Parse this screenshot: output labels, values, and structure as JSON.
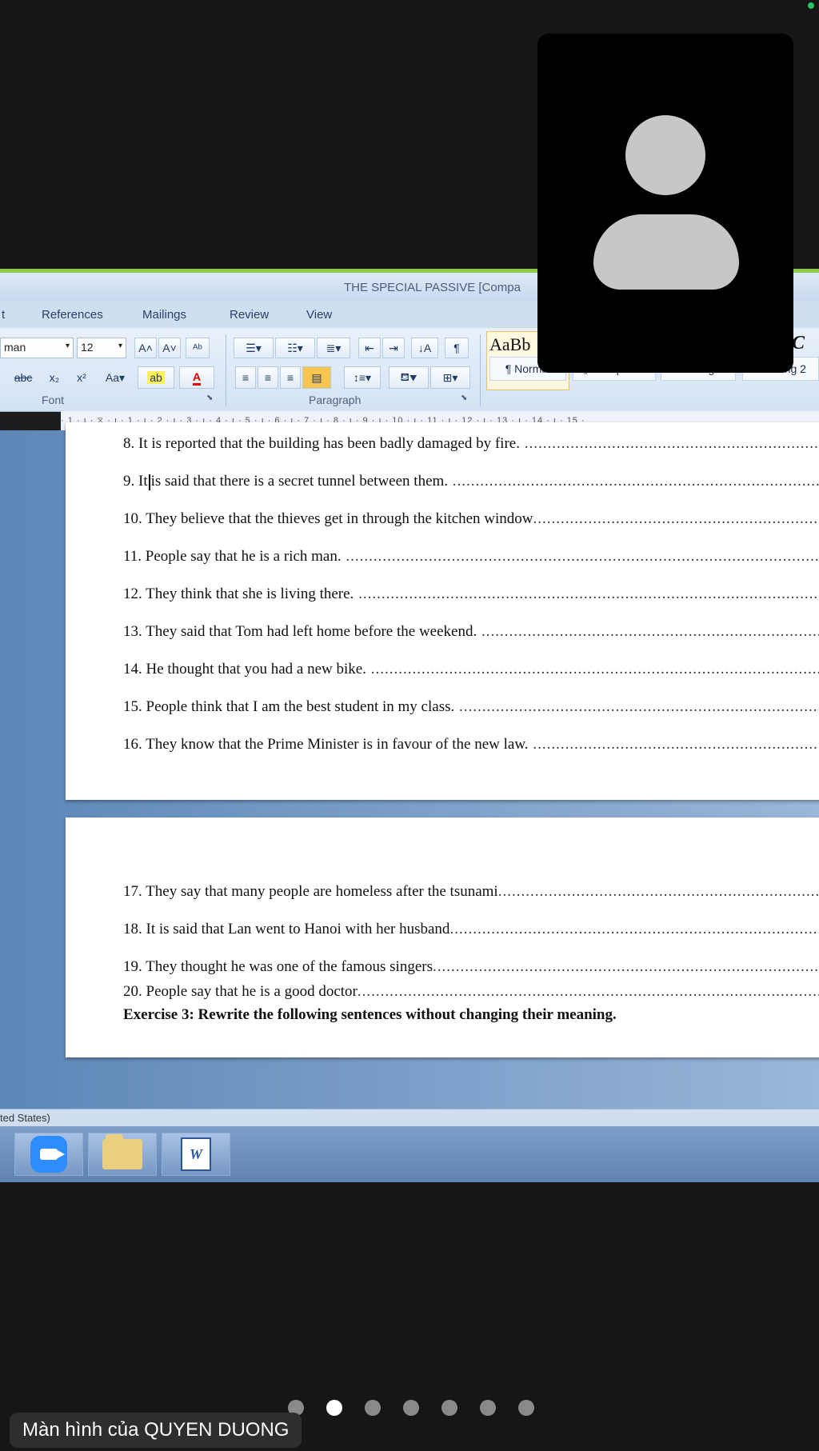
{
  "window": {
    "title": "THE SPECIAL PASSIVE [Compa"
  },
  "ribbon_tabs": [
    "t",
    "References",
    "Mailings",
    "Review",
    "View"
  ],
  "font": {
    "name": "man",
    "size": "12"
  },
  "groups": {
    "font_label": "Font",
    "paragraph_label": "Paragraph"
  },
  "styles": {
    "preview_left": "AaBb",
    "preview_right": "bC",
    "items": [
      "¶ Normal",
      "¶ No Spaci...",
      "Heading 1",
      "Heading 2"
    ]
  },
  "ruler": {
    "text": "· 1 · ı · ⧖ · ı · 1 · ı · 2 · ı · 3 · ı · 4 · ı · 5 · ı · 6 · ı · 7 · ı · 8 · ı · 9 · ı · 10 · ı · 11 · ı · 12 · ı · 13 · ı · 14 · ı · 15 ·"
  },
  "document": {
    "page1": [
      {
        "text": "8. It is reported that the building has been badly damaged by fire.",
        "dots": " ............................................................................"
      },
      {
        "text_a": "9. It",
        "text_b": "is said that there is a secret tunnel between them.",
        "dots": " ........................................................................................"
      },
      {
        "text": "10. They believe that the thieves get in through the kitchen window",
        "dots": "................................................................"
      },
      {
        "text": "11. People say that he is a rich man.",
        "dots": " ..............................................................................................................................."
      },
      {
        "text": "12. They think that she is living there.",
        "dots": " ..........................................................................................................................."
      },
      {
        "text": "13. They said that Tom had left home before the weekend.",
        "dots": " ..............................................................................."
      },
      {
        "text": "14. He thought that you had a new bike.",
        "dots": " .........................................................................................................................."
      },
      {
        "text": "15. People think that I am the best student in my class.",
        "dots": " ..................................................................................."
      },
      {
        "text": "16. They know that the Prime Minister is in favour of the new law.",
        "dots": " ....................................................................."
      }
    ],
    "page2": [
      {
        "text": "17. They say that many people are homeless after the tsunami",
        "dots": "......................................................................."
      },
      {
        "text": "18. It is said that Lan went to Hanoi with her husband",
        "dots": "............................................................................................"
      },
      {
        "text": "19. They thought he was one of the famous singers",
        "dots": "................................................................................................"
      },
      {
        "text": "20. People say that he is a good doctor",
        "dots": "..........................................................................................................................."
      }
    ],
    "exercise3": "Exercise 3: Rewrite the following sentences without changing their meaning."
  },
  "status": {
    "language": "ted States)"
  },
  "overlay": {
    "sharer_label": "Màn hình của QUYEN DUONG",
    "page_count": 7,
    "active_page": 1
  }
}
